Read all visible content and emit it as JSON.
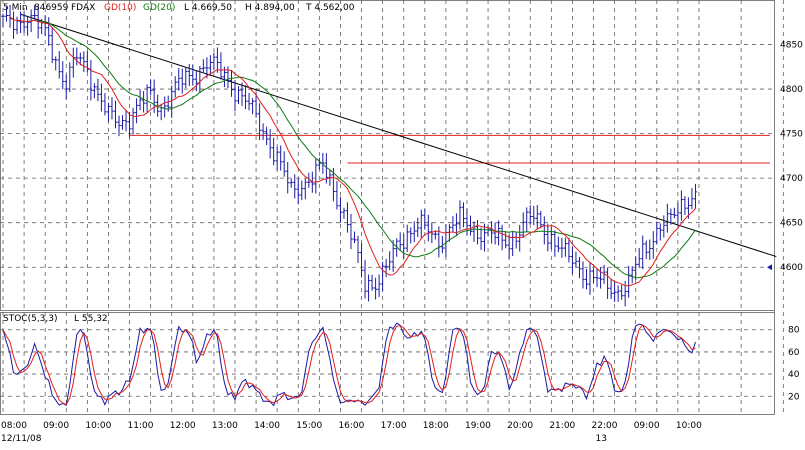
{
  "header": {
    "interval": "5 Min",
    "symbol_id": "846959",
    "symbol": "FDAX",
    "ma1_label": "GD(10)",
    "ma2_label": "GD(20)",
    "low_text": "L  4.669,50",
    "high_text": "H  4.894,00",
    "last_text": "T  4.562,00"
  },
  "stoch_header": {
    "label": "STOC(5,3,3)",
    "last_text": "L  55,32"
  },
  "colors": {
    "price_bars": "#1a1aa6",
    "ma10": "#e0201c",
    "ma20": "#0e7a0e",
    "trendline": "#000000",
    "hlines": "#e02020",
    "stoch_k": "#1a1aa6",
    "stoch_d": "#e0201c",
    "grid": "#606060",
    "label_color": "#2a2ab0"
  },
  "chart_data": [
    {
      "type": "line",
      "title": "",
      "y_ticks": [
        4600,
        4650,
        4700,
        4750,
        4800,
        4850
      ],
      "ylim": [
        4552,
        4900
      ],
      "x_tick_labels": [
        "08:00",
        "09:00",
        "10:00",
        "11:00",
        "12:00",
        "13:00",
        "14:00",
        "15:00",
        "16:00",
        "17:00",
        "18:00",
        "19:00",
        "20:00",
        "21:00",
        "22:00",
        "09:00",
        "10:00"
      ],
      "x_ticks_bar_index": [
        0,
        12,
        24,
        36,
        48,
        60,
        72,
        84,
        96,
        108,
        120,
        132,
        144,
        156,
        168,
        180,
        192
      ],
      "date_labels": [
        {
          "bar_index": 0,
          "text": "12/11/08"
        },
        {
          "bar_index": 168,
          "text": "13"
        }
      ],
      "bar_count": 198,
      "price_anchors": [
        {
          "bar": 0,
          "value": 4872
        },
        {
          "bar": 4,
          "value": 4876
        },
        {
          "bar": 7,
          "value": 4882
        },
        {
          "bar": 10,
          "value": 4870
        },
        {
          "bar": 13,
          "value": 4858
        },
        {
          "bar": 16,
          "value": 4823
        },
        {
          "bar": 18,
          "value": 4805
        },
        {
          "bar": 21,
          "value": 4835
        },
        {
          "bar": 24,
          "value": 4824
        },
        {
          "bar": 27,
          "value": 4795
        },
        {
          "bar": 30,
          "value": 4768
        },
        {
          "bar": 33,
          "value": 4762
        },
        {
          "bar": 36,
          "value": 4770
        },
        {
          "bar": 39,
          "value": 4782
        },
        {
          "bar": 42,
          "value": 4793
        },
        {
          "bar": 45,
          "value": 4780
        },
        {
          "bar": 48,
          "value": 4795
        },
        {
          "bar": 51,
          "value": 4808
        },
        {
          "bar": 55,
          "value": 4820
        },
        {
          "bar": 58,
          "value": 4828
        },
        {
          "bar": 61,
          "value": 4822
        },
        {
          "bar": 64,
          "value": 4812
        },
        {
          "bar": 67,
          "value": 4795
        },
        {
          "bar": 70,
          "value": 4780
        },
        {
          "bar": 73,
          "value": 4762
        },
        {
          "bar": 76,
          "value": 4740
        },
        {
          "bar": 79,
          "value": 4712
        },
        {
          "bar": 82,
          "value": 4685
        },
        {
          "bar": 85,
          "value": 4695
        },
        {
          "bar": 88,
          "value": 4700
        },
        {
          "bar": 91,
          "value": 4712
        },
        {
          "bar": 94,
          "value": 4690
        },
        {
          "bar": 97,
          "value": 4660
        },
        {
          "bar": 100,
          "value": 4620
        },
        {
          "bar": 103,
          "value": 4582
        },
        {
          "bar": 106,
          "value": 4584
        },
        {
          "bar": 109,
          "value": 4596
        },
        {
          "bar": 112,
          "value": 4622
        },
        {
          "bar": 115,
          "value": 4640
        },
        {
          "bar": 118,
          "value": 4648
        },
        {
          "bar": 121,
          "value": 4638
        },
        {
          "bar": 124,
          "value": 4630
        },
        {
          "bar": 127,
          "value": 4645
        },
        {
          "bar": 130,
          "value": 4652
        },
        {
          "bar": 133,
          "value": 4645
        },
        {
          "bar": 136,
          "value": 4640
        },
        {
          "bar": 139,
          "value": 4635
        },
        {
          "bar": 142,
          "value": 4628
        },
        {
          "bar": 145,
          "value": 4632
        },
        {
          "bar": 148,
          "value": 4648
        },
        {
          "bar": 151,
          "value": 4655
        },
        {
          "bar": 154,
          "value": 4645
        },
        {
          "bar": 157,
          "value": 4628
        },
        {
          "bar": 160,
          "value": 4612
        },
        {
          "bar": 163,
          "value": 4605
        },
        {
          "bar": 166,
          "value": 4592
        },
        {
          "bar": 169,
          "value": 4585
        },
        {
          "bar": 172,
          "value": 4578
        },
        {
          "bar": 175,
          "value": 4575
        },
        {
          "bar": 178,
          "value": 4582
        },
        {
          "bar": 181,
          "value": 4608
        },
        {
          "bar": 184,
          "value": 4630
        },
        {
          "bar": 187,
          "value": 4648
        },
        {
          "bar": 190,
          "value": 4650
        },
        {
          "bar": 193,
          "value": 4670
        },
        {
          "bar": 196,
          "value": 4684
        },
        {
          "bar": 197,
          "value": 4678
        }
      ],
      "trendline": [
        {
          "bar": 5,
          "value": 4884
        },
        {
          "bar": 220,
          "value": 4612
        }
      ],
      "horizontal_lines": [
        {
          "from_bar": 36,
          "value": 4748
        },
        {
          "from_bar": 98,
          "value": 4717
        }
      ],
      "last_price_marker": 4600
    },
    {
      "type": "line",
      "title": "STOC(5,3,3)",
      "y_ticks": [
        20,
        40,
        60,
        80
      ],
      "ylim": [
        4,
        96
      ],
      "series": [
        {
          "name": "%K",
          "values_from": "computed from price bars (5)"
        },
        {
          "name": "%D",
          "values_from": "3-period smoothing of %K"
        }
      ]
    }
  ]
}
